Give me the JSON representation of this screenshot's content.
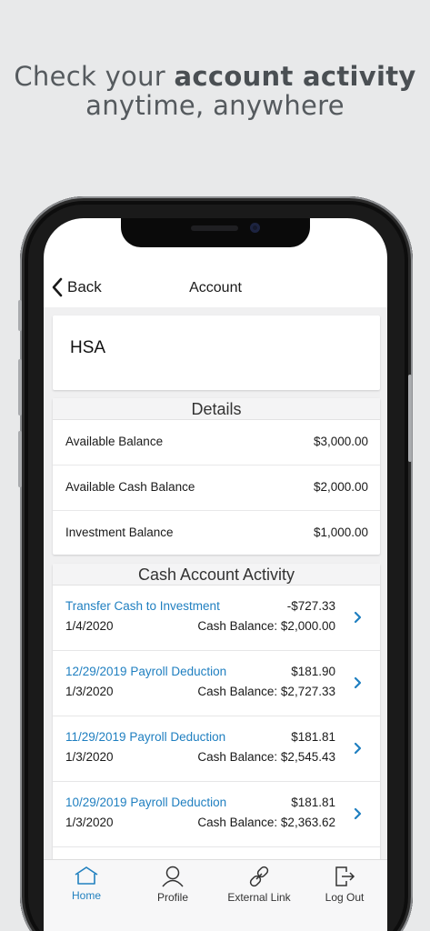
{
  "promo": {
    "line1_prefix": "Check your ",
    "line1_bold": "account activity",
    "line2": "anytime, anywhere"
  },
  "nav": {
    "back_label": "Back",
    "title": "Account"
  },
  "account": {
    "name": "HSA"
  },
  "details": {
    "header": "Details",
    "rows": [
      {
        "label": "Available Balance",
        "value": "$3,000.00"
      },
      {
        "label": "Available Cash Balance",
        "value": "$2,000.00"
      },
      {
        "label": "Investment Balance",
        "value": "$1,000.00"
      }
    ]
  },
  "activity": {
    "header": "Cash Account Activity",
    "rows": [
      {
        "description": "Transfer Cash to Investment",
        "amount": "-$727.33",
        "date": "1/4/2020",
        "balance": "Cash Balance: $2,000.00"
      },
      {
        "description": "12/29/2019 Payroll Deduction",
        "amount": "$181.90",
        "date": "1/3/2020",
        "balance": "Cash Balance: $2,727.33"
      },
      {
        "description": "11/29/2019 Payroll Deduction",
        "amount": "$181.81",
        "date": "1/3/2020",
        "balance": "Cash Balance: $2,545.43"
      },
      {
        "description": "10/29/2019 Payroll Deduction",
        "amount": "$181.81",
        "date": "1/3/2020",
        "balance": "Cash Balance: $2,363.62"
      }
    ]
  },
  "tabs": [
    {
      "label": "Home",
      "icon": "home-icon",
      "active": true
    },
    {
      "label": "Profile",
      "icon": "person-icon",
      "active": false
    },
    {
      "label": "External Link",
      "icon": "link-icon",
      "active": false
    },
    {
      "label": "Log Out",
      "icon": "logout-icon",
      "active": false
    }
  ],
  "colors": {
    "accent": "#1f7fc0",
    "background": "#e8e9ea",
    "content_bg": "#f0f0f1"
  }
}
